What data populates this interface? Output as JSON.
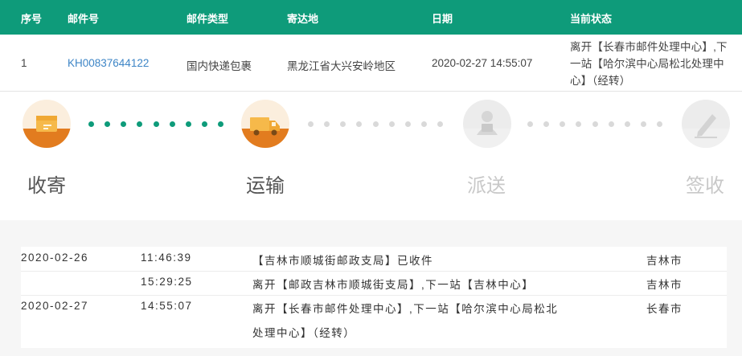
{
  "table": {
    "headers": [
      "序号",
      "邮件号",
      "邮件类型",
      "寄达地",
      "日期",
      "当前状态"
    ],
    "row": {
      "index": "1",
      "mail_no": "KH00837644122",
      "mail_type": "国内快递包裹",
      "destination": "黑龙江省大兴安岭地区",
      "date": "2020-02-27 14:55:07",
      "status": "离开【长春市邮件处理中心】,下一站【哈尔滨中心局松北处理中心】（经转）"
    }
  },
  "tracker": {
    "steps": [
      {
        "label": "收寄",
        "icon": "package-icon",
        "state": "done"
      },
      {
        "label": "运输",
        "icon": "truck-icon",
        "state": "current"
      },
      {
        "label": "派送",
        "icon": "courier-icon",
        "state": "pending"
      },
      {
        "label": "签收",
        "icon": "sign-icon",
        "state": "pending"
      }
    ],
    "colors": {
      "accent": "#0e9b7a",
      "step_active": "#e27c1f",
      "inactive": "#d9d9d9"
    }
  },
  "log": [
    {
      "date": "2020-02-26",
      "time": "11:46:39",
      "desc_1": "【吉林市顺城街邮政支局】已收件",
      "desc_2": "",
      "city": "吉林市"
    },
    {
      "date": "",
      "time": "15:29:25",
      "desc_1": "离开【邮政吉林市顺城街支局】,下一站【吉林中心】",
      "desc_2": "",
      "city": "吉林市"
    },
    {
      "date": "2020-02-27",
      "time": "14:55:07",
      "desc_1": "离开【长春市邮件处理中心】,下一站【哈尔滨中心局松北",
      "desc_2": "处理中心】（经转）",
      "city": "长春市"
    }
  ]
}
